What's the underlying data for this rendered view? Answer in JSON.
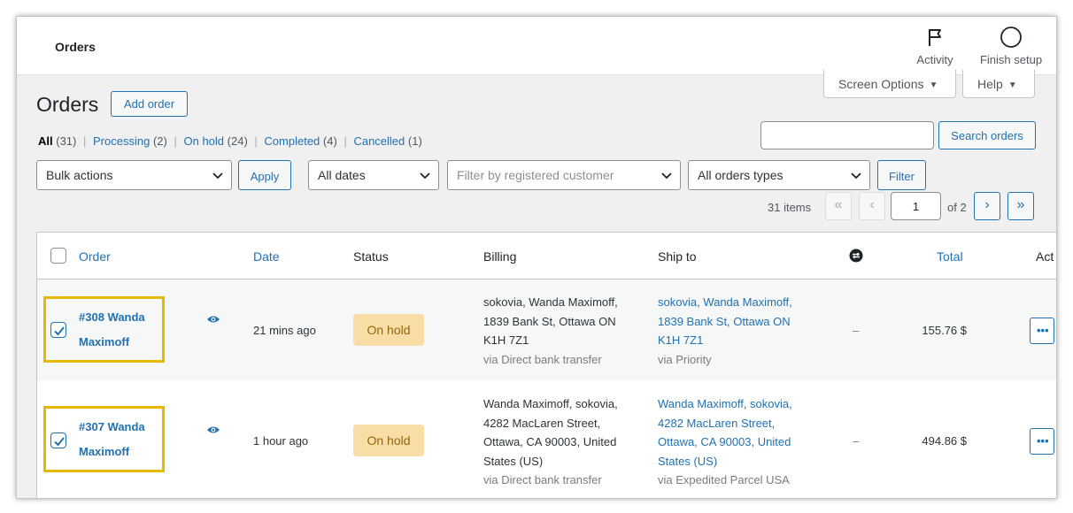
{
  "topbar": {
    "title": "Orders",
    "activity_label": "Activity",
    "finish_setup_label": "Finish setup"
  },
  "tabs": {
    "screen_options": "Screen Options",
    "help": "Help"
  },
  "heading": {
    "title": "Orders",
    "add_order": "Add order"
  },
  "views": [
    {
      "label": "All",
      "count": "(31)"
    },
    {
      "label": "Processing",
      "count": "(2)"
    },
    {
      "label": "On hold",
      "count": "(24)"
    },
    {
      "label": "Completed",
      "count": "(4)"
    },
    {
      "label": "Cancelled",
      "count": "(1)"
    }
  ],
  "search": {
    "value": "",
    "button": "Search orders"
  },
  "filters": {
    "bulk_actions": "Bulk actions",
    "apply": "Apply",
    "dates": "All dates",
    "customer_placeholder": "Filter by registered customer",
    "order_types": "All orders types",
    "filter": "Filter"
  },
  "pagination": {
    "items": "31 items",
    "first": "«",
    "prev": "‹",
    "current": "1",
    "of": "of 2",
    "next": "›",
    "last": "»"
  },
  "columns": {
    "order": "Order",
    "date": "Date",
    "status": "Status",
    "billing": "Billing",
    "ship_to": "Ship to",
    "total": "Total",
    "actions": "Act"
  },
  "rows": [
    {
      "order": "#308 Wanda Maximoff",
      "date": "21 mins ago",
      "status": "On hold",
      "billing_lines": [
        "sokovia, Wanda Maximoff,",
        "1839 Bank St, Ottawa ON",
        "K1H 7Z1"
      ],
      "billing_via": "via Direct bank transfer",
      "ship_lines": [
        "sokovia, Wanda Maximoff,",
        "1839 Bank St, Ottawa ON",
        "K1H 7Z1"
      ],
      "ship_via": "via Priority",
      "origin": "–",
      "total": "155.76 $",
      "checked": true
    },
    {
      "order": "#307 Wanda Maximoff",
      "date": "1 hour ago",
      "status": "On hold",
      "billing_lines": [
        "Wanda Maximoff, sokovia,",
        "4282 MacLaren Street,",
        "Ottawa, CA 90003, United",
        "States (US)"
      ],
      "billing_via": "via Direct bank transfer",
      "ship_lines": [
        "Wanda Maximoff, sokovia,",
        "4282 MacLaren Street,",
        "Ottawa, CA 90003, United",
        "States (US)"
      ],
      "ship_via": "via Expedited Parcel USA",
      "origin": "–",
      "total": "494.86 $",
      "checked": true
    }
  ],
  "colors": {
    "accent": "#2271b1",
    "highlight": "#e6b800",
    "on_hold_bg": "#f8dda7",
    "on_hold_text": "#94660c"
  },
  "icons": {
    "activity": "flag-icon",
    "finish_setup": "circle-progress-icon",
    "origin": "sync-icon",
    "preview": "eye-icon",
    "more": "ellipsis-icon"
  }
}
